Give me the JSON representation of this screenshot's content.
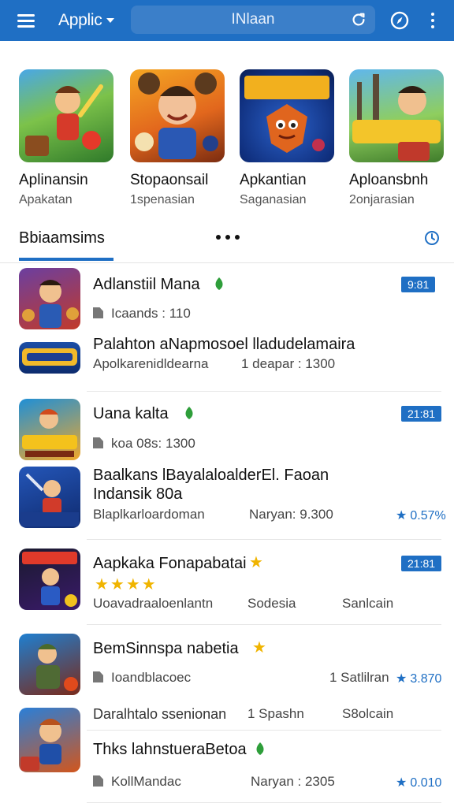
{
  "header": {
    "app_title": "Applic",
    "search_placeholder": "INlaan",
    "menu_icon": "menu-icon",
    "refresh_icon": "refresh-icon",
    "compass_icon": "compass-icon",
    "more_icon": "more-vert-icon",
    "bar_color": "#1f6fc4"
  },
  "featured": [
    {
      "name": "Aplinansin",
      "sub": "Apakatan"
    },
    {
      "name": "Stopaonsail",
      "sub": "1spenasian"
    },
    {
      "name": "Apkantian",
      "sub": "Saganasian"
    },
    {
      "name": "Aploansbnh",
      "sub": "2onjarasian"
    }
  ],
  "tabs": {
    "active": "Bbiaamsims",
    "dots_icon": "more-horiz-icon",
    "clock_icon": "clock-icon"
  },
  "list": [
    {
      "title": "Adlanstiil Mana",
      "meta": "Icaands : 110",
      "badge": "9:81"
    },
    {
      "title": "Palahton aNapmosoel lladudelamaira",
      "meta_left": "Apolkarenidldearna",
      "meta_right": "1 deapar : 1300"
    },
    {
      "title": "Uana kalta",
      "meta": "koa 08s: 1300",
      "badge": "21:81"
    },
    {
      "title_line1": "Baalkans lBayalaloalderEl. Faoan",
      "title_line2": "Indansik 80a",
      "meta_left": "Blaplkarloardoman",
      "meta_mid": "Naryan: 9.300",
      "rating": "0.57%"
    },
    {
      "title": "Aapkaka Fonapabatai",
      "meta_left": "Uoavadraaloenlantn",
      "meta_mid": "Sodesia",
      "meta_right": "Sanlcain",
      "badge": "21:81",
      "stars": "★★★★"
    },
    {
      "title": "BemSinnspa nabetia",
      "meta": "Ioandblacoec",
      "meta_mid": "1 Satlilran",
      "rating": "3.870"
    },
    {
      "title": "Daralhtalo  ssenionan",
      "meta_mid": "1 Spashn",
      "meta_right": "S8olcain"
    },
    {
      "title": "Thks lahnstueraBetoa",
      "meta": "KollMandac",
      "meta_mid": "Naryan : 2305",
      "rating": "0.010"
    }
  ],
  "accent": "#1f6fc4",
  "star_color": "#f0b400"
}
